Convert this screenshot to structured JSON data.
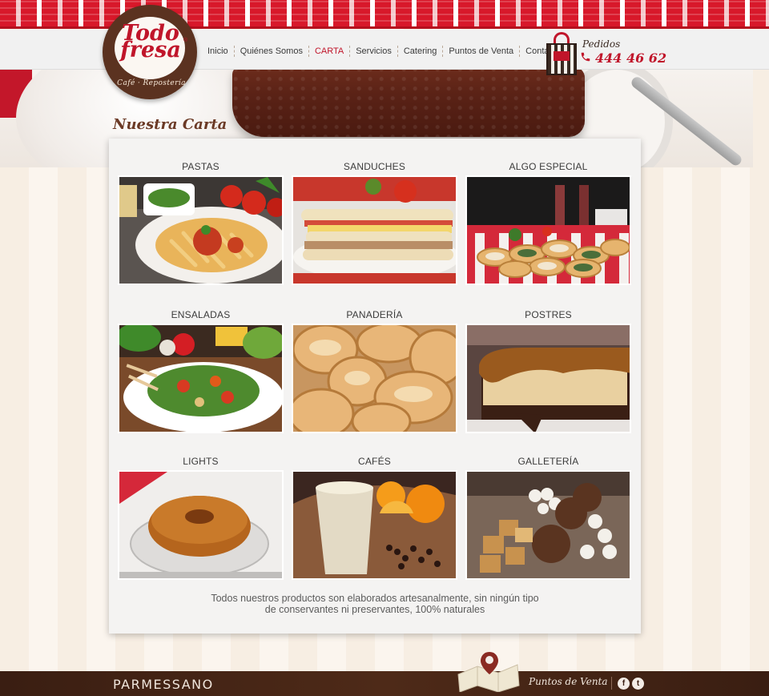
{
  "brand": {
    "name": "Todo fresa",
    "registered": "®",
    "tagline": "Café · Repostería"
  },
  "nav": {
    "items": [
      {
        "label": "Inicio",
        "active": false
      },
      {
        "label": "Quiénes Somos",
        "active": false
      },
      {
        "label": "CARTA",
        "active": true
      },
      {
        "label": "Servicios",
        "active": false
      },
      {
        "label": "Catering",
        "active": false
      },
      {
        "label": "Puntos de Venta",
        "active": false
      },
      {
        "label": "Contacto",
        "active": false
      }
    ]
  },
  "order": {
    "label": "Pedidos",
    "phone": "444 46 62"
  },
  "page": {
    "title": "Nuestra Carta"
  },
  "categories": [
    {
      "title": "PASTAS"
    },
    {
      "title": "SANDUCHES"
    },
    {
      "title": "ALGO ESPECIAL"
    },
    {
      "title": "ENSALADAS"
    },
    {
      "title": "PANADERÍA"
    },
    {
      "title": "POSTRES"
    },
    {
      "title": "LIGHTS"
    },
    {
      "title": "CAFÉS"
    },
    {
      "title": "GALLETERÍA"
    }
  ],
  "footnote": {
    "line1": "Todos nuestros productos son elaborados artesanalmente, sin ningún tipo",
    "line2": "de conservantes ni preservantes, 100% naturales"
  },
  "footer": {
    "left_text": "PARMESSANO",
    "puntos_label": "Puntos de Venta",
    "social": [
      {
        "icon": "facebook-icon",
        "glyph": "f"
      },
      {
        "icon": "twitter-icon",
        "glyph": "t"
      }
    ]
  },
  "colors": {
    "accent": "#c0152a",
    "brown": "#5b3220",
    "card": "#f4f3f2"
  }
}
